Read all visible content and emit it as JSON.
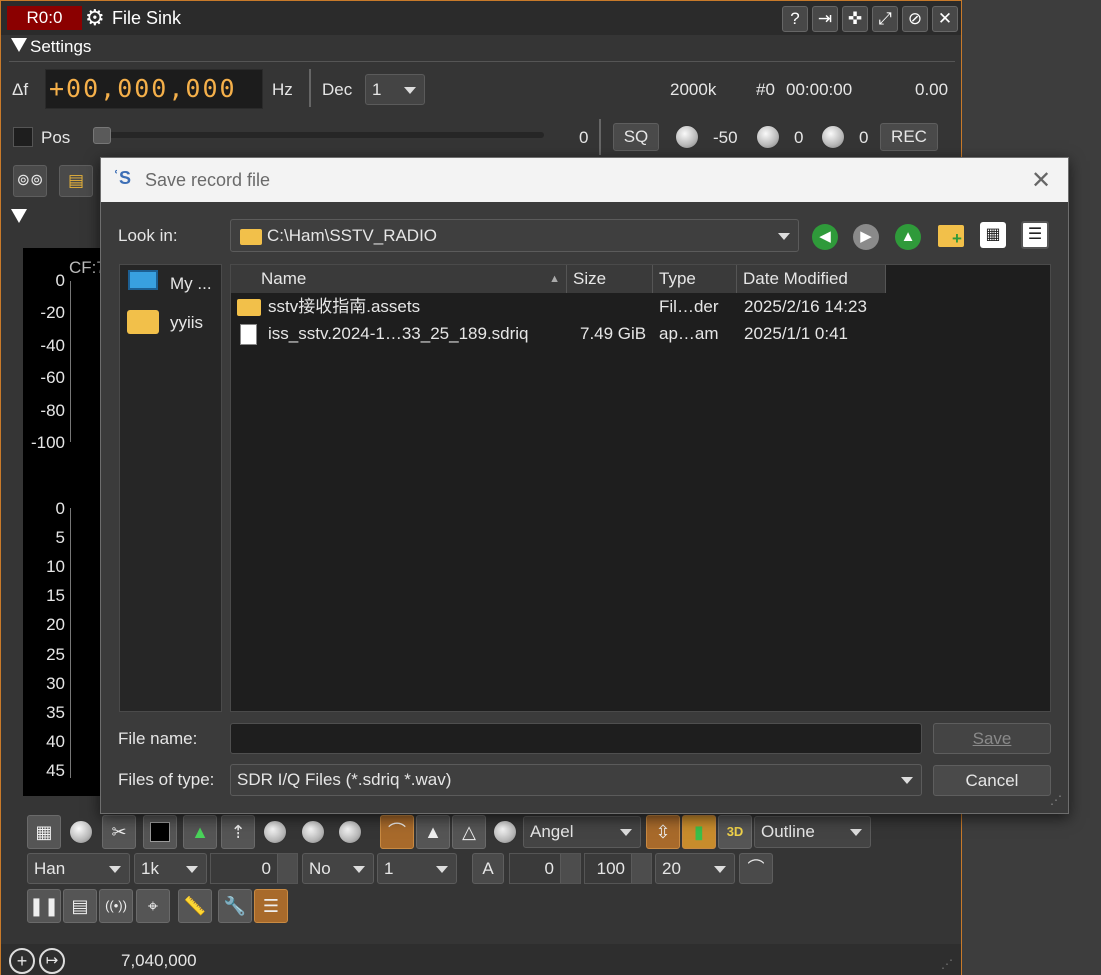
{
  "window": {
    "rx_badge": "R0:0",
    "title": "File Sink",
    "title_buttons": [
      "help-icon",
      "exit-icon",
      "shrink-icon",
      "expand-icon",
      "hide-icon",
      "close-icon"
    ]
  },
  "settings": {
    "section_label": "Settings",
    "delta_f_label": "Δf",
    "freq_digits": "+00,000,000",
    "hz_label": "Hz",
    "dec_label": "Dec",
    "dec_value": "1",
    "sample_rate": "2000k",
    "record_index": "#0",
    "record_time": "00:00:00",
    "record_size": "0.00",
    "pos_label": "Pos",
    "pos_value": "0",
    "sq_label": "SQ",
    "sq_level": "-50",
    "knob2_value": "0",
    "knob3_value": "0",
    "rec_label": "REC"
  },
  "spectrum": {
    "cf_label": "CF:7",
    "y_ticks": [
      "0",
      "-20",
      "-40",
      "-60",
      "-80",
      "-100"
    ],
    "waterfall_ticks": [
      "0",
      "5",
      "10",
      "15",
      "20",
      "25",
      "30",
      "35",
      "40",
      "45"
    ]
  },
  "toolbar": {
    "palette": "Angel",
    "outline": "Outline",
    "window_fn": "Han",
    "fft_size": "1k",
    "ref_value": "0",
    "overlap": "No",
    "averaging": "1",
    "a_label": "A",
    "a_value": "0",
    "range_value": "100",
    "rate_value": "20"
  },
  "status": {
    "frequency": "7,040,000"
  },
  "dialog": {
    "title": "Save record file",
    "look_in_label": "Look in:",
    "look_in_path": "C:\\Ham\\SSTV_RADIO",
    "sidebar": [
      {
        "label": "My ...",
        "icon": "computer-icon"
      },
      {
        "label": "yyiis",
        "icon": "folder-icon"
      }
    ],
    "columns": {
      "name": "Name",
      "size": "Size",
      "type": "Type",
      "date": "Date Modified"
    },
    "files": [
      {
        "name": "sstv接收指南.assets",
        "size": "",
        "type": "Fil…der",
        "date": "2025/2/16 14:23",
        "icon": "folder-icon"
      },
      {
        "name": "iss_sstv.2024-1…33_25_189.sdriq",
        "size": "7.49 GiB",
        "type": "ap…am",
        "date": "2025/1/1 0:41",
        "icon": "file-icon"
      }
    ],
    "file_name_label": "File name:",
    "file_name_value": "",
    "file_type_label": "Files of type:",
    "file_type_value": "SDR I/Q Files (*.sdriq *.wav)",
    "save_label": "Save",
    "cancel_label": "Cancel"
  }
}
